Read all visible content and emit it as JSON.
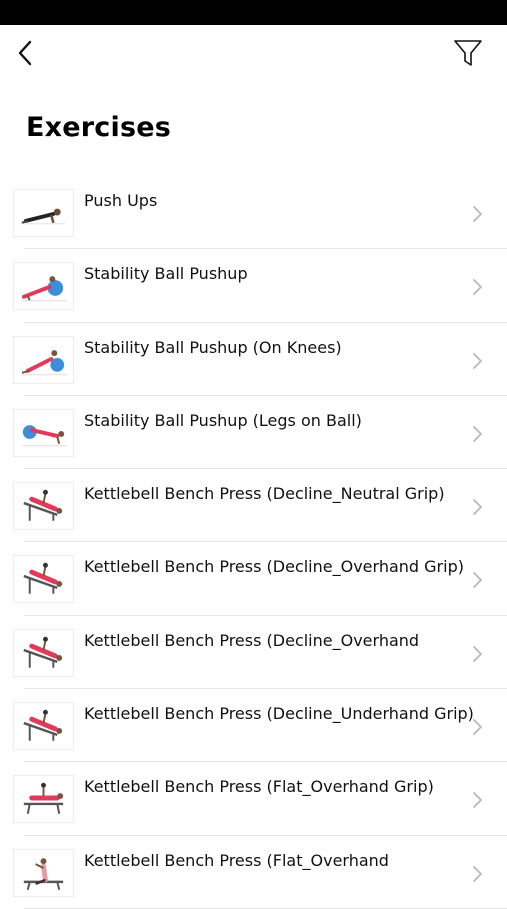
{
  "header": {
    "back_icon": "chevron-left-icon",
    "filter_icon": "filter-funnel-icon"
  },
  "page": {
    "title": "Exercises"
  },
  "exercises": [
    {
      "name": "Push Ups",
      "figure": "pushup-floor"
    },
    {
      "name": "Stability Ball Pushup",
      "figure": "ball-pushup"
    },
    {
      "name": "Stability Ball Pushup (On Knees)",
      "figure": "ball-pushup-knees"
    },
    {
      "name": "Stability Ball Pushup (Legs on Ball)",
      "figure": "legs-on-ball"
    },
    {
      "name": "Kettlebell Bench Press (Decline_Neutral Grip)",
      "figure": "decline-bench"
    },
    {
      "name": "Kettlebell Bench Press (Decline_Overhand Grip)",
      "figure": "decline-bench"
    },
    {
      "name": "Kettlebell Bench Press (Decline_Overhand",
      "figure": "decline-bench"
    },
    {
      "name": "Kettlebell Bench Press (Decline_Underhand Grip)",
      "figure": "decline-bench"
    },
    {
      "name": "Kettlebell Bench Press (Flat_Overhand Grip)",
      "figure": "flat-bench"
    },
    {
      "name": "Kettlebell Bench Press (Flat_Overhand",
      "figure": "flat-bench-seated"
    }
  ],
  "row_icon": "chevron-right-icon",
  "colors": {
    "status_bar": "#000000",
    "chevron": "#b8b8b8",
    "divider": "#e6e6e6",
    "ball": "#3a8fd8",
    "shirt": "#e23a5a"
  }
}
